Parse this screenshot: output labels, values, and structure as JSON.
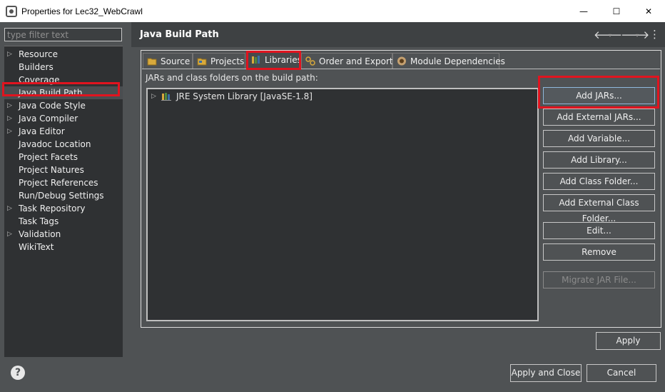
{
  "window": {
    "title": "Properties for Lec32_WebCrawl",
    "minimize": "—",
    "maximize": "☐",
    "close": "✕"
  },
  "sidebar": {
    "filter_placeholder": "type filter text",
    "items": [
      {
        "label": "Resource",
        "expandable": true
      },
      {
        "label": "Builders",
        "expandable": false
      },
      {
        "label": "Coverage",
        "expandable": false
      },
      {
        "label": "Java Build Path",
        "expandable": false,
        "selected": true
      },
      {
        "label": "Java Code Style",
        "expandable": true
      },
      {
        "label": "Java Compiler",
        "expandable": true
      },
      {
        "label": "Java Editor",
        "expandable": true
      },
      {
        "label": "Javadoc Location",
        "expandable": false
      },
      {
        "label": "Project Facets",
        "expandable": false
      },
      {
        "label": "Project Natures",
        "expandable": false
      },
      {
        "label": "Project References",
        "expandable": false
      },
      {
        "label": "Run/Debug Settings",
        "expandable": false
      },
      {
        "label": "Task Repository",
        "expandable": true
      },
      {
        "label": "Task Tags",
        "expandable": false
      },
      {
        "label": "Validation",
        "expandable": true
      },
      {
        "label": "WikiText",
        "expandable": false
      }
    ]
  },
  "page": {
    "title": "Java Build Path",
    "back_arrow": "🡐",
    "forward_arrow": "🡒",
    "menu": "⋮"
  },
  "tabs": [
    {
      "label": "Source"
    },
    {
      "label": "Projects"
    },
    {
      "label": "Libraries",
      "active": true
    },
    {
      "label": "Order and Export"
    },
    {
      "label": "Module Dependencies"
    }
  ],
  "libraries": {
    "description": "JARs and class folders on the build path:",
    "entries": [
      {
        "label": "JRE System Library [JavaSE-1.8]"
      }
    ]
  },
  "buttons": {
    "add_jars": "Add JARs...",
    "add_external_jars": "Add External JARs...",
    "add_variable": "Add Variable...",
    "add_library": "Add Library...",
    "add_class_folder": "Add Class Folder...",
    "add_external_class_folder": "Add External Class Folder...",
    "edit": "Edit...",
    "remove": "Remove",
    "migrate_jar": "Migrate JAR File...",
    "apply": "Apply"
  },
  "footer": {
    "help": "?",
    "apply_and_close": "Apply and Close",
    "cancel": "Cancel"
  },
  "colors": {
    "highlight": "#e0141f",
    "background": "#4f5254",
    "tree_background": "#2f3133"
  }
}
